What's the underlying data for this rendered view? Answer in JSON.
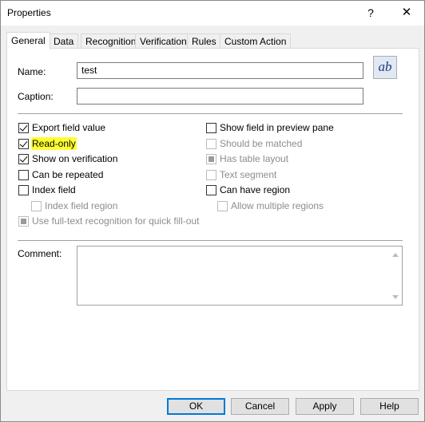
{
  "window": {
    "title": "Properties",
    "help_label": "?",
    "close_label": "✕"
  },
  "tabs": [
    "General",
    "Data",
    "Recognition",
    "Verification",
    "Rules",
    "Custom Action"
  ],
  "form": {
    "name_label": "Name:",
    "name_value": "test",
    "caption_label": "Caption:",
    "caption_value": "",
    "ab_label": "ab"
  },
  "checkboxes_left": [
    {
      "label": "Export field value",
      "checked": true
    },
    {
      "label": "Read-only",
      "checked": true
    },
    {
      "label": "Show on verification",
      "checked": true
    },
    {
      "label": "Can be repeated",
      "checked": false
    },
    {
      "label": "Index field",
      "checked": false
    },
    {
      "label": "Index field region",
      "checked": false,
      "disabled": true
    },
    {
      "label": "Use full-text recognition for quick fill-out",
      "checked": false,
      "disabled": true,
      "indeterminate": true
    }
  ],
  "checkboxes_right": [
    {
      "label": "Show field in preview pane",
      "checked": false
    },
    {
      "label": "Should be matched",
      "checked": false,
      "disabled": true
    },
    {
      "label": "Has table layout",
      "checked": false,
      "disabled": true,
      "indeterminate": true
    },
    {
      "label": "Text segment",
      "checked": false,
      "disabled": true
    },
    {
      "label": "Can have region",
      "checked": false
    },
    {
      "label": "Allow multiple regions",
      "checked": false,
      "disabled": true
    }
  ],
  "comment": {
    "label": "Comment:",
    "value": ""
  },
  "buttons": {
    "ok": "OK",
    "cancel": "Cancel",
    "apply": "Apply",
    "help": "Help"
  },
  "colors": {
    "highlight": "#ffff33",
    "default_button_border": "#0078d7"
  }
}
